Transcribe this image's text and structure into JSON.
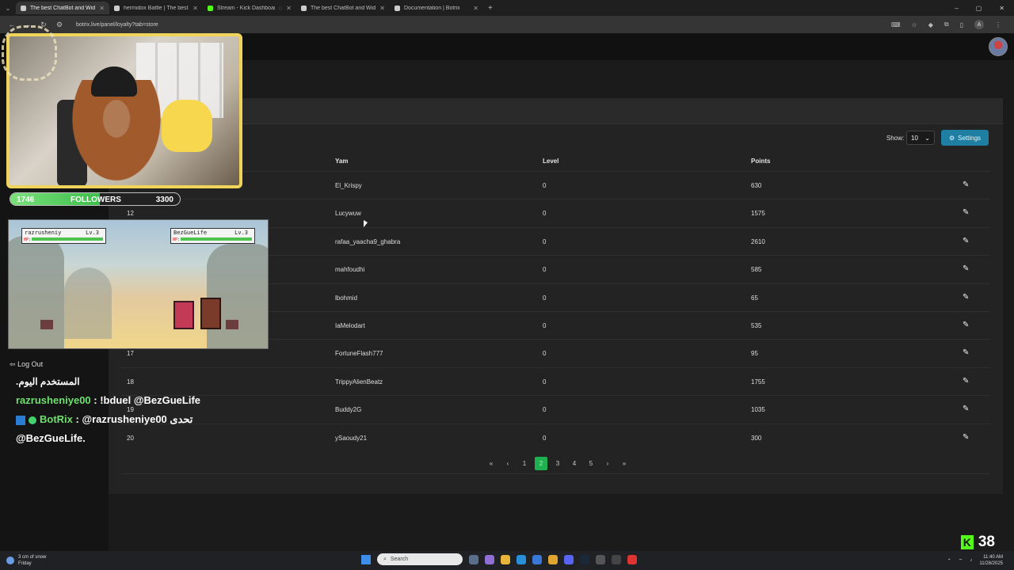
{
  "browser": {
    "tabs": [
      {
        "title": "The best ChatBot and Widgets",
        "active": true
      },
      {
        "title": "hermidox Battle | The best Cha",
        "active": false
      },
      {
        "title": "Stream - Kick Dashboard",
        "active": false
      },
      {
        "title": "The best ChatBot and Widgets",
        "active": false
      },
      {
        "title": "Documentation | Botrix",
        "active": false
      }
    ],
    "url": "botrix.live/panel/loyalty?tab=store",
    "profile_initial": "A"
  },
  "table": {
    "show_label": "Show:",
    "page_size": "10",
    "settings_label": "Settings",
    "headers": {
      "name": "Yam",
      "level": "Level",
      "points": "Points"
    },
    "rows": [
      {
        "id": "",
        "name": "El_Krispy",
        "level": "0",
        "points": "630"
      },
      {
        "id": "12",
        "name": "Lucywuw",
        "level": "0",
        "points": "1575"
      },
      {
        "id": "",
        "name": "rafaa_yaacha9_ghabra",
        "level": "0",
        "points": "2610"
      },
      {
        "id": "",
        "name": "mahfoudhi",
        "level": "0",
        "points": "585"
      },
      {
        "id": "",
        "name": "lbohmid",
        "level": "0",
        "points": "65"
      },
      {
        "id": "",
        "name": "IaMelodart",
        "level": "0",
        "points": "535"
      },
      {
        "id": "17",
        "name": "FortuneFlash777",
        "level": "0",
        "points": "95"
      },
      {
        "id": "18",
        "name": "TrippyAlienBeatz",
        "level": "0",
        "points": "1755"
      },
      {
        "id": "19",
        "name": "Buddy2G",
        "level": "0",
        "points": "1035"
      },
      {
        "id": "20",
        "name": "ySaoudy21",
        "level": "0",
        "points": "300"
      }
    ],
    "pagination": {
      "first": "«",
      "prev": "‹",
      "pages": [
        "1",
        "2",
        "3",
        "4",
        "5"
      ],
      "current": "2",
      "next": "›",
      "last": "»"
    }
  },
  "sidebar": {
    "logout_label": "Log Out"
  },
  "overlay": {
    "followers": {
      "current": "1746",
      "label": "FOLLOWERS",
      "goal": "3300",
      "progress": 0.529
    },
    "battle": {
      "player1": {
        "name": "razrusheniy",
        "level": "Lv.3",
        "hp_label": "HP:"
      },
      "player2": {
        "name": "BezGueLife",
        "level": "Lv.3",
        "hp_label": "HP:"
      }
    },
    "chat": {
      "line0": "المستخدم اليوم.",
      "msg1_user": "razrusheniye00",
      "msg1_text": " : !bduel @BezGueLife",
      "msg2_user": "BotRix",
      "msg2_text": " : @razrusheniye00 تحدى",
      "msg2_cont": "@BezGueLife."
    },
    "kick_viewers": "38"
  },
  "taskbar": {
    "weather_line1": "3 cm of snow",
    "weather_line2": "Friday",
    "search_placeholder": "Search",
    "time": "11:40 AM",
    "date": "11/28/2025"
  },
  "colors": {
    "accent": "#1e7fa3",
    "active_page": "#1fb050",
    "kick_green": "#53fc18"
  }
}
